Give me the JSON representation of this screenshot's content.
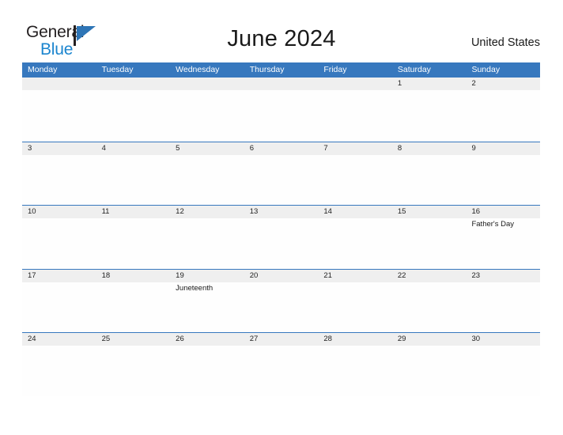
{
  "brand": {
    "name_top": "General",
    "name_bottom": "Blue",
    "flag_icon": "flag-icon",
    "color_text": "#231f20",
    "color_blue": "#1b85cf",
    "color_flag": "#2e75b6"
  },
  "header": {
    "title": "June 2024",
    "locale": "United States"
  },
  "theme": {
    "header_blue": "#3778be",
    "band_gray": "#efefef",
    "page_bg": "#ffffff"
  },
  "calendar": {
    "weekdays": [
      "Monday",
      "Tuesday",
      "Wednesday",
      "Thursday",
      "Friday",
      "Saturday",
      "Sunday"
    ],
    "weeks": [
      [
        {
          "day": "",
          "event": ""
        },
        {
          "day": "",
          "event": ""
        },
        {
          "day": "",
          "event": ""
        },
        {
          "day": "",
          "event": ""
        },
        {
          "day": "",
          "event": ""
        },
        {
          "day": "1",
          "event": ""
        },
        {
          "day": "2",
          "event": ""
        }
      ],
      [
        {
          "day": "3",
          "event": ""
        },
        {
          "day": "4",
          "event": ""
        },
        {
          "day": "5",
          "event": ""
        },
        {
          "day": "6",
          "event": ""
        },
        {
          "day": "7",
          "event": ""
        },
        {
          "day": "8",
          "event": ""
        },
        {
          "day": "9",
          "event": ""
        }
      ],
      [
        {
          "day": "10",
          "event": ""
        },
        {
          "day": "11",
          "event": ""
        },
        {
          "day": "12",
          "event": ""
        },
        {
          "day": "13",
          "event": ""
        },
        {
          "day": "14",
          "event": ""
        },
        {
          "day": "15",
          "event": ""
        },
        {
          "day": "16",
          "event": "Father's Day"
        }
      ],
      [
        {
          "day": "17",
          "event": ""
        },
        {
          "day": "18",
          "event": ""
        },
        {
          "day": "19",
          "event": "Juneteenth"
        },
        {
          "day": "20",
          "event": ""
        },
        {
          "day": "21",
          "event": ""
        },
        {
          "day": "22",
          "event": ""
        },
        {
          "day": "23",
          "event": ""
        }
      ],
      [
        {
          "day": "24",
          "event": ""
        },
        {
          "day": "25",
          "event": ""
        },
        {
          "day": "26",
          "event": ""
        },
        {
          "day": "27",
          "event": ""
        },
        {
          "day": "28",
          "event": ""
        },
        {
          "day": "29",
          "event": ""
        },
        {
          "day": "30",
          "event": ""
        }
      ]
    ]
  }
}
